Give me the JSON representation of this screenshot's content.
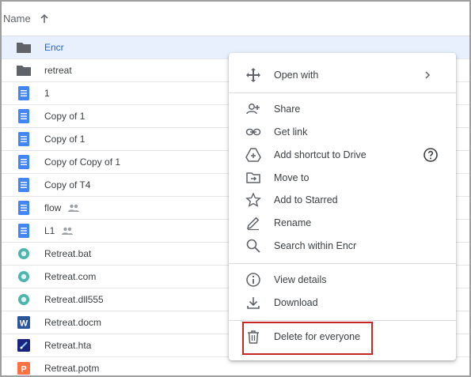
{
  "header": {
    "name_label": "Name"
  },
  "files": [
    {
      "name": "Encr",
      "icon": "folder-icon",
      "selected": true,
      "shared": false
    },
    {
      "name": "retreat",
      "icon": "folder-icon",
      "selected": false,
      "shared": false
    },
    {
      "name": "1",
      "icon": "doc-icon",
      "selected": false,
      "shared": false
    },
    {
      "name": "Copy of 1",
      "icon": "doc-icon",
      "selected": false,
      "shared": false
    },
    {
      "name": "Copy of 1",
      "icon": "doc-icon",
      "selected": false,
      "shared": false
    },
    {
      "name": "Copy of Copy of 1",
      "icon": "doc-icon",
      "selected": false,
      "shared": false
    },
    {
      "name": "Copy of T4",
      "icon": "doc-icon",
      "selected": false,
      "shared": false
    },
    {
      "name": "flow",
      "icon": "doc-icon",
      "selected": false,
      "shared": true
    },
    {
      "name": "L1",
      "icon": "doc-icon",
      "selected": false,
      "shared": true
    },
    {
      "name": "Retreat.bat",
      "icon": "generic-file-icon",
      "selected": false,
      "shared": false
    },
    {
      "name": "Retreat.com",
      "icon": "generic-file-icon",
      "selected": false,
      "shared": false
    },
    {
      "name": "Retreat.dll555",
      "icon": "generic-file-icon",
      "selected": false,
      "shared": false
    },
    {
      "name": "Retreat.docm",
      "icon": "word-icon",
      "selected": false,
      "shared": false
    },
    {
      "name": "Retreat.hta",
      "icon": "hta-icon",
      "selected": false,
      "shared": false
    },
    {
      "name": "Retreat.potm",
      "icon": "powerpoint-icon",
      "selected": false,
      "shared": false
    }
  ],
  "context_menu": {
    "open_with": "Open with",
    "share": "Share",
    "get_link": "Get link",
    "add_shortcut": "Add shortcut to Drive",
    "move_to": "Move to",
    "add_starred": "Add to Starred",
    "rename": "Rename",
    "search_within": "Search within Encr",
    "view_details": "View details",
    "download": "Download",
    "delete_everyone": "Delete for everyone"
  },
  "colors": {
    "selected_row_bg": "#e8f0fe",
    "selected_text": "#1967d2",
    "folder": "#5f6368",
    "doc_blue": "#4285f4",
    "generic_teal": "#4db6ac",
    "word_blue": "#2b579a",
    "powerpoint_orange": "#ff7043",
    "highlight_red": "#c62828"
  }
}
